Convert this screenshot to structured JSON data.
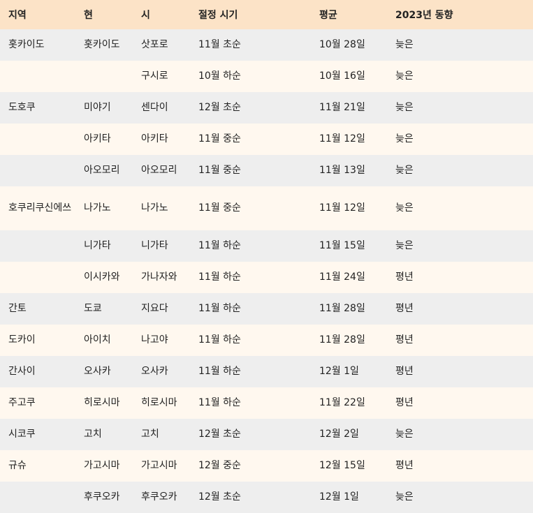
{
  "colors": {
    "header_bg": "#fce3c7",
    "row_odd_bg": "#eeeeee",
    "row_even_bg": "#fff8ef",
    "text": "#222222"
  },
  "table": {
    "headers": [
      "지역",
      "현",
      "시",
      "절정 시기",
      "평균",
      "2023년 동향"
    ],
    "rows": [
      [
        "홋카이도",
        "홋카이도",
        "삿포로",
        "11월 초순",
        "10월 28일",
        "늦은"
      ],
      [
        "",
        "",
        "구시로",
        "10월 하순",
        "10월 16일",
        "늦은"
      ],
      [
        "도호쿠",
        "미야기",
        "센다이",
        "12월 초순",
        "11월 21일",
        "늦은"
      ],
      [
        "",
        "아키타",
        "아키타",
        "11월 중순",
        "11월 12일",
        "늦은"
      ],
      [
        "",
        "아오모리",
        "아오모리",
        "11월 중순",
        "11월 13일",
        "늦은"
      ],
      [
        "호쿠리쿠신에쓰",
        "나가노",
        "나가노",
        "11월 중순",
        "11월 12일",
        "늦은"
      ],
      [
        "",
        "니가타",
        "니가타",
        "11월 하순",
        "11월 15일",
        "늦은"
      ],
      [
        "",
        "이시카와",
        "가나자와",
        "11월 하순",
        "11월 24일",
        "평년"
      ],
      [
        "간토",
        "도쿄",
        "지요다",
        "11월 하순",
        "11월 28일",
        "평년"
      ],
      [
        "도카이",
        "아이치",
        "나고야",
        "11월 하순",
        "11월 28일",
        "평년"
      ],
      [
        "간사이",
        "오사카",
        "오사카",
        "11월 하순",
        "12월 1일",
        "평년"
      ],
      [
        "주고쿠",
        "히로시마",
        "히로시마",
        "11월 하순",
        "11월 22일",
        "평년"
      ],
      [
        "시코쿠",
        "고치",
        "고치",
        "12월 초순",
        "12월 2일",
        "늦은"
      ],
      [
        "규슈",
        "가고시마",
        "가고시마",
        "12월 중순",
        "12월 15일",
        "평년"
      ],
      [
        "",
        "후쿠오카",
        "후쿠오카",
        "12월 초순",
        "12월 1일",
        "늦은"
      ]
    ]
  }
}
